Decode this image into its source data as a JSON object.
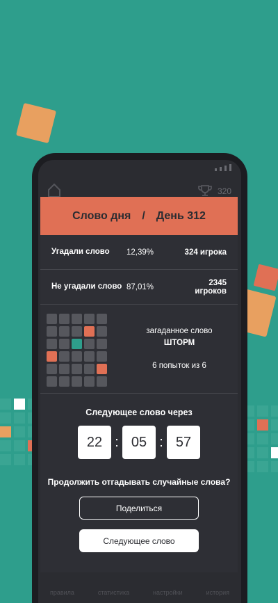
{
  "header": {
    "title": "Слово дня",
    "separator": "/",
    "day": "День 312"
  },
  "topbar": {
    "streak_count": "320"
  },
  "stats": [
    {
      "label": "Угадали слово",
      "percent": "12,39%",
      "players": "324 игрока"
    },
    {
      "label": "Не угадали слово",
      "percent": "87,01%",
      "players": "2345 игроков"
    }
  ],
  "result": {
    "caption": "загаданное слово",
    "word": "ШТОРМ",
    "tries": "6 попыток из 6",
    "grid": [
      [
        "gray",
        "gray",
        "gray",
        "gray",
        "gray"
      ],
      [
        "gray",
        "gray",
        "gray",
        "red",
        "gray"
      ],
      [
        "gray",
        "gray",
        "green",
        "gray",
        "gray"
      ],
      [
        "red",
        "gray",
        "gray",
        "gray",
        "gray"
      ],
      [
        "gray",
        "gray",
        "gray",
        "gray",
        "red"
      ],
      [
        "gray",
        "gray",
        "gray",
        "gray",
        "gray"
      ]
    ]
  },
  "timer": {
    "label": "Следующее слово через",
    "hours": "22",
    "minutes": "05",
    "seconds": "57",
    "colon": ":"
  },
  "prompt": "Продолжить отгадывать случайные слова?",
  "buttons": {
    "share": "Поделиться",
    "next": "Следующее слово"
  },
  "bottom_nav": [
    "правила",
    "статистика",
    "настройки",
    "история"
  ],
  "colors": {
    "background": "#2e9e8c",
    "accent": "#e07055",
    "panel": "#2e2f35"
  }
}
